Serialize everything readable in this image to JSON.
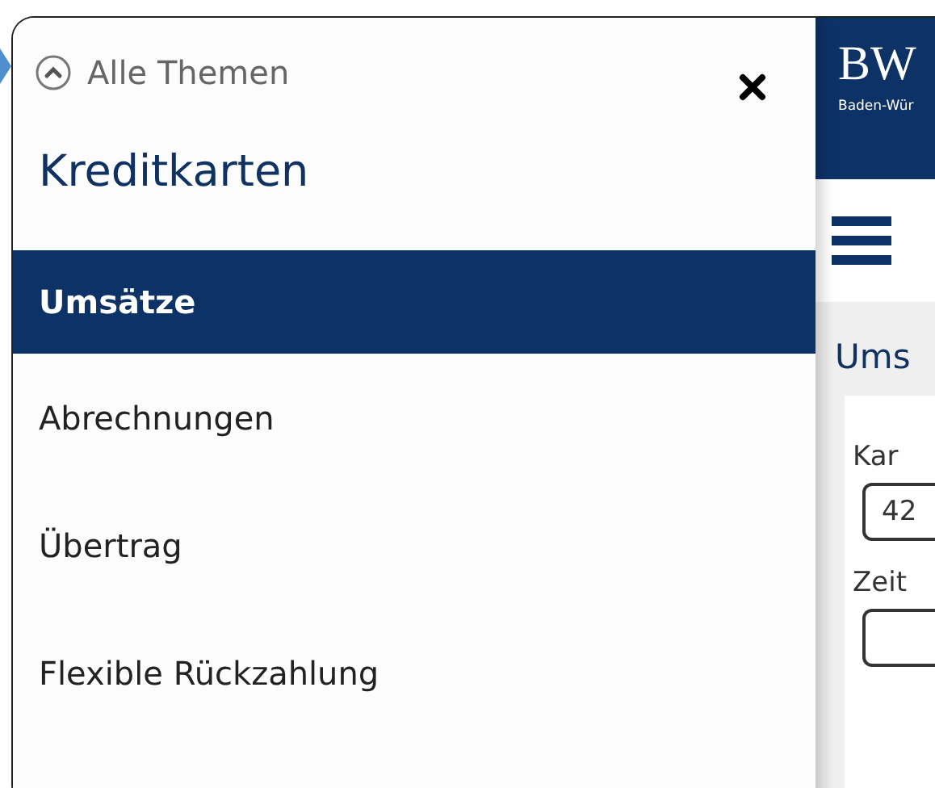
{
  "drawer": {
    "back_link": "Alle Themen",
    "title": "Kreditkarten",
    "items": [
      {
        "label": "Umsätze",
        "selected": true
      },
      {
        "label": "Abrechnungen",
        "selected": false
      },
      {
        "label": "Übertrag",
        "selected": false
      },
      {
        "label": "Flexible Rückzahlung",
        "selected": false
      }
    ]
  },
  "app": {
    "logo": "BW",
    "logo_subtitle": "Baden-Wür",
    "page_title": "Ums",
    "fields": [
      {
        "label": "Kar",
        "value": "42"
      },
      {
        "label": "Zeit"
      }
    ]
  }
}
